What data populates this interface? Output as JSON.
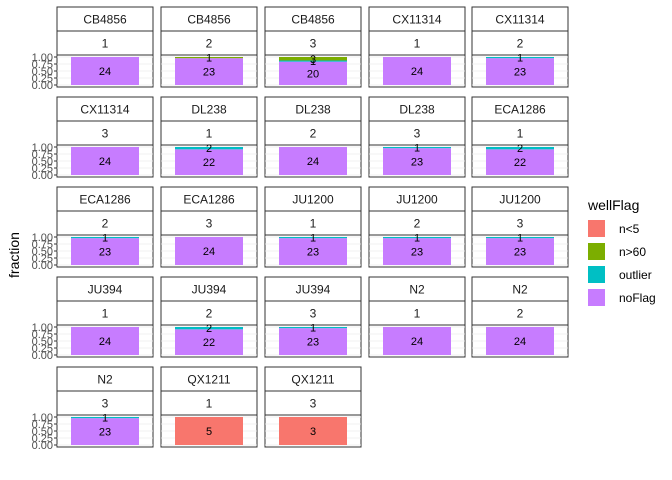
{
  "chart_data": {
    "type": "bar",
    "stacked": true,
    "facet_layout": "wrap",
    "facet_columns": 5,
    "ylabel": "fraction",
    "ylim": [
      0,
      1
    ],
    "yticks": [
      "0.00",
      "0.25",
      "0.50",
      "0.75",
      "1.00"
    ],
    "grid": true,
    "legend": {
      "title": "wellFlag",
      "placement": "right",
      "items": [
        {
          "label": "n<5",
          "color": "#F8766D"
        },
        {
          "label": "n>60",
          "color": "#7CAE00"
        },
        {
          "label": "outlier",
          "color": "#00BFC4"
        },
        {
          "label": "noFlag",
          "color": "#C77CFF"
        }
      ]
    },
    "stack_order_bottom_to_top": [
      "noFlag",
      "outlier",
      "n>60",
      "n<5"
    ],
    "panels": [
      {
        "strain": "CB4856",
        "replicate": "1",
        "counts": {
          "noFlag": 24
        }
      },
      {
        "strain": "CB4856",
        "replicate": "2",
        "counts": {
          "noFlag": 23,
          "n>60": 1
        }
      },
      {
        "strain": "CB4856",
        "replicate": "3",
        "counts": {
          "noFlag": 20,
          "n>60": 3,
          "outlier": 1
        }
      },
      {
        "strain": "CX11314",
        "replicate": "1",
        "counts": {
          "noFlag": 24
        }
      },
      {
        "strain": "CX11314",
        "replicate": "2",
        "counts": {
          "noFlag": 23,
          "outlier": 1
        }
      },
      {
        "strain": "CX11314",
        "replicate": "3",
        "counts": {
          "noFlag": 24
        }
      },
      {
        "strain": "DL238",
        "replicate": "1",
        "counts": {
          "noFlag": 22,
          "outlier": 2
        }
      },
      {
        "strain": "DL238",
        "replicate": "2",
        "counts": {
          "noFlag": 24
        }
      },
      {
        "strain": "DL238",
        "replicate": "3",
        "counts": {
          "noFlag": 23,
          "outlier": 1
        }
      },
      {
        "strain": "ECA1286",
        "replicate": "1",
        "counts": {
          "noFlag": 22,
          "outlier": 2
        }
      },
      {
        "strain": "ECA1286",
        "replicate": "2",
        "counts": {
          "noFlag": 23,
          "outlier": 1
        }
      },
      {
        "strain": "ECA1286",
        "replicate": "3",
        "counts": {
          "noFlag": 24
        }
      },
      {
        "strain": "JU1200",
        "replicate": "1",
        "counts": {
          "noFlag": 23,
          "outlier": 1
        }
      },
      {
        "strain": "JU1200",
        "replicate": "2",
        "counts": {
          "noFlag": 23,
          "outlier": 1
        }
      },
      {
        "strain": "JU1200",
        "replicate": "3",
        "counts": {
          "noFlag": 23,
          "outlier": 1
        }
      },
      {
        "strain": "JU394",
        "replicate": "1",
        "counts": {
          "noFlag": 24
        }
      },
      {
        "strain": "JU394",
        "replicate": "2",
        "counts": {
          "noFlag": 22,
          "outlier": 2
        }
      },
      {
        "strain": "JU394",
        "replicate": "3",
        "counts": {
          "noFlag": 23,
          "outlier": 1
        }
      },
      {
        "strain": "N2",
        "replicate": "1",
        "counts": {
          "noFlag": 24
        }
      },
      {
        "strain": "N2",
        "replicate": "2",
        "counts": {
          "noFlag": 24
        }
      },
      {
        "strain": "N2",
        "replicate": "3",
        "counts": {
          "noFlag": 23,
          "outlier": 1
        }
      },
      {
        "strain": "QX1211",
        "replicate": "1",
        "counts": {
          "n<5": 5
        }
      },
      {
        "strain": "QX1211",
        "replicate": "3",
        "counts": {
          "n<5": 3
        }
      }
    ]
  }
}
